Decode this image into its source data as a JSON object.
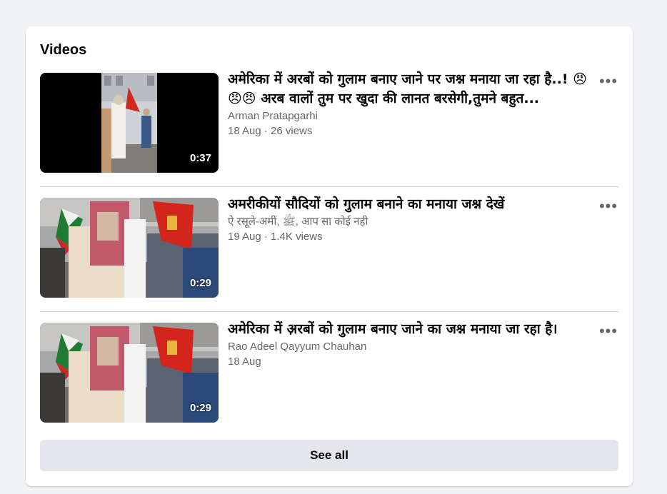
{
  "section": {
    "title": "Videos",
    "see_all_label": "See all"
  },
  "videos": [
    {
      "title": "अमेरिका में अरबों को गुलाम बनाए जाने पर जश्न मनाया जा रहा है..! 😠😠😠 अरब वालों तुम पर खुदा की लानत बरसेगी,तुमने बहुत...",
      "author": "Arman Pratapgarhi",
      "meta": "18 Aug · 26 views",
      "duration": "0:37",
      "more_icon": "more-horizontal-icon"
    },
    {
      "title": "अमरीकीयों सौदियों को गुलाम बनाने का मनाया जश्न देखें",
      "author": "ऐ रसूले-अमीं, ﷺ, आप सा कोई नही",
      "meta": "19 Aug · 1.4K views",
      "duration": "0:29",
      "more_icon": "more-horizontal-icon"
    },
    {
      "title": "अमेरिका में अ़रबों को गुलाम बनाए जाने का जश्न मनाया जा रहा है।",
      "author": "Rao Adeel Qayyum Chauhan",
      "meta": "18 Aug",
      "duration": "0:29",
      "more_icon": "more-horizontal-icon"
    }
  ],
  "colors": {
    "page_bg": "#f0f2f5",
    "card_bg": "#ffffff",
    "primary_text": "#050505",
    "secondary_text": "#65676b",
    "button_bg": "#e4e6eb",
    "divider": "#ced0d4"
  }
}
